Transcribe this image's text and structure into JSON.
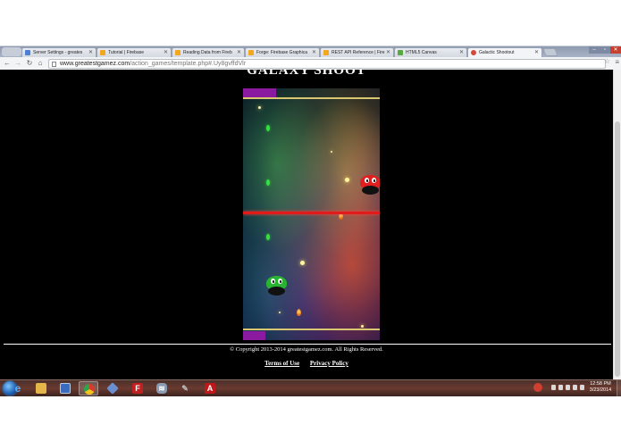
{
  "browser": {
    "tabs": [
      {
        "title": "Server Settings - greates",
        "favicon_color": "#4a7fd4"
      },
      {
        "title": "Tutorial | Firebase",
        "favicon_color": "#f2a71c"
      },
      {
        "title": "Reading Data from Fireb",
        "favicon_color": "#f2a71c"
      },
      {
        "title": "Forge: Firebase Graphica",
        "favicon_color": "#f2a71c"
      },
      {
        "title": "REST API Reference | Fire",
        "favicon_color": "#f2a71c"
      },
      {
        "title": "HTML5 Canvas",
        "favicon_color": "#5aa844"
      },
      {
        "title": "Galactic Shootout",
        "favicon_color": "#d44a3a"
      }
    ],
    "active_tab_index": 6,
    "url_host": "www.greatestgamez.com",
    "url_path": "/action_games/template.php#.Uy8gvffdVlr",
    "icons": {
      "back": "back-arrow-icon",
      "forward": "forward-arrow-icon",
      "reload": "reload-icon",
      "home": "home-icon",
      "bookmark": "star-icon",
      "menu": "hamburger-menu-icon"
    }
  },
  "page": {
    "title": "GALAXY SHOOT",
    "copyright": "© Copyright 2013-2014 greatestgamez.com. All Rights Reserved.",
    "links": {
      "terms": "Terms of Use",
      "privacy": "Privacy Policy"
    }
  },
  "game": {
    "player_alien_color": "#28b432",
    "enemy_alien_color": "#e02020",
    "laser_color": "#e11a1a",
    "hud_color": "#8a1aa0"
  },
  "taskbar": {
    "apps": [
      {
        "name": "internet-explorer",
        "glyph": "e",
        "color": "#2f7fd8"
      },
      {
        "name": "file-explorer",
        "glyph": "▬",
        "color": "#e4b64a"
      },
      {
        "name": "remote-desktop",
        "glyph": "▭",
        "color": "#3b6cc0"
      },
      {
        "name": "chrome",
        "glyph": "●",
        "color": "#e0a12a"
      },
      {
        "name": "virtualbox",
        "glyph": "◆",
        "color": "#6a8fd0"
      },
      {
        "name": "filezilla",
        "glyph": "F",
        "color": "#c02020"
      },
      {
        "name": "network-tool",
        "glyph": "≋",
        "color": "#8a9ab0"
      },
      {
        "name": "tools",
        "glyph": "✎",
        "color": "#7a7a7a"
      },
      {
        "name": "adobe-reader",
        "glyph": "A",
        "color": "#c01818"
      }
    ],
    "clock_time": "12:58 PM",
    "clock_date": "3/23/2014"
  }
}
